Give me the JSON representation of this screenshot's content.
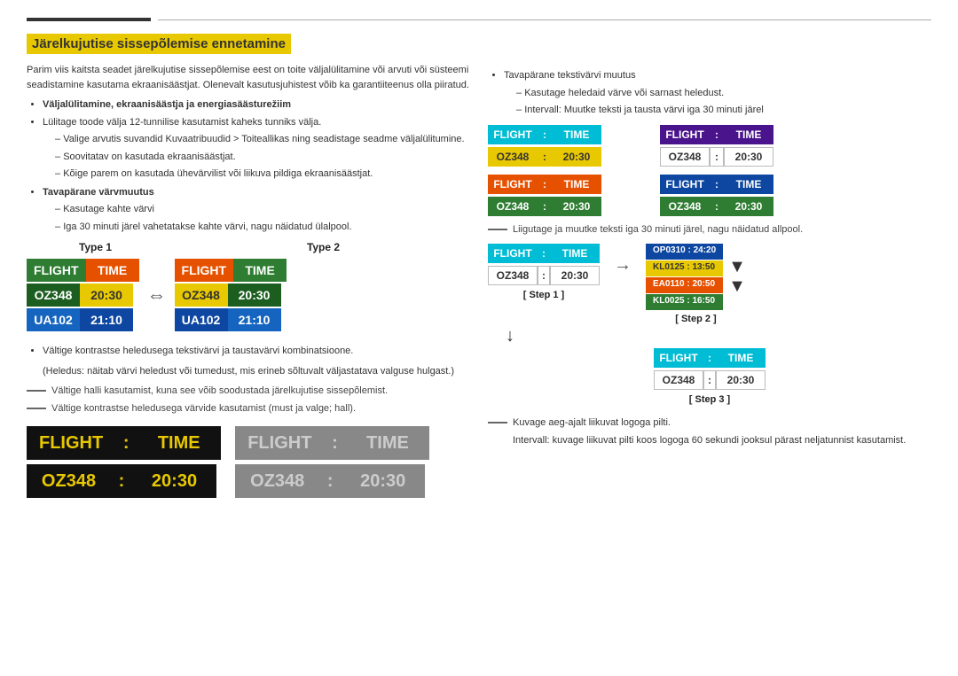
{
  "title": "Järelkujutise sissepõlemise ennetamine",
  "topline": {
    "intro": "Parim viis kaitsta seadet järelkujutise sissepõlemise eest on toite väljalülitamine või arvuti või süsteemi seadistamine kasutama ekraanisäästjat. Olenevalt kasutusjuhistest võib ka garantiiteenus olla piiratud."
  },
  "section1": {
    "title": "Väljalülitamine, ekraanisäästja ja energiasäästurežiim",
    "items": [
      "Lülitage toode välja 12-tunnilise kasutamist kaheks tunniks välja.",
      "Valige arvutis suvandid Kuvaatribuudid > Toiteallikas ning seadistage seadme väljalülitumine.",
      "Soovitatav on kasutada ekraanisäästjat.",
      "Kõige parem on kasutada ühevärvilist või liikuva pildiga ekraanisäästjat."
    ]
  },
  "section2": {
    "title": "Tavapärane värvmuutus",
    "items": [
      "Kasutage kahte värvi",
      "Iga 30 minuti järel vahetatakse kahte värvi, nagu näidatud ülalpool."
    ]
  },
  "section3": {
    "title": "Tavapärane tekstivärvi muutus",
    "items": [
      "Kasutage heledaid värve või sarnast heledust.",
      "Intervall: Muutke teksti ja tausta värvi iga 30 minuti järel"
    ]
  },
  "type1_label": "Type 1",
  "type2_label": "Type 2",
  "boards": {
    "t1_r1_c1": "FLIGHT",
    "t1_r1_c2": "TIME",
    "t1_r2_c1": "OZ348",
    "t1_r2_c2": "20:30",
    "t1_r3_c1": "UA102",
    "t1_r3_c2": "21:10",
    "t2_r1_c1": "FLIGHT",
    "t2_r1_c2": "TIME",
    "t2_r2_c1": "OZ348",
    "t2_r2_c2": "20:30",
    "t2_r3_c1": "UA102",
    "t2_r3_c2": "21:10"
  },
  "bottom_note1": "Vältige kontrastse heledusega tekstivärvi ja taustavärvi kombinatsioone.",
  "bottom_note2": "(Heledus: näitab värvi heledust või tumedust, mis erineb sõltuvalt väljastatava valguse hulgast.)",
  "warn1": "Vältige halli kasutamist, kuna see võib soodustada järelkujutise sissepõlemist.",
  "warn2": "Vältige kontrastse heledusega värvide kasutamist (must ja valge; hall).",
  "big_boards": {
    "r1_c1": "FLIGHT",
    "r1_colon": ":",
    "r1_c2": "TIME",
    "r2_c1": "OZ348",
    "r2_colon": ":",
    "r2_c2": "20:30",
    "r1b_c1": "FLIGHT",
    "r1b_colon": ":",
    "r1b_c2": "TIME",
    "r2b_c1": "OZ348",
    "r2b_colon": ":",
    "r2b_c2": "20:30"
  },
  "right_boards": {
    "b1_r1_c1": "FLIGHT",
    "b1_r1_c2": ":",
    "b1_r1_c3": "TIME",
    "b1_r2_c1": "OZ348",
    "b1_r2_c2": ":",
    "b1_r2_c3": "20:30",
    "b2_r1_c1": "FLIGHT",
    "b2_r1_c2": ":",
    "b2_r1_c3": "TIME",
    "b2_r2_c1": "OZ348",
    "b2_r2_c2": ":",
    "b2_r2_c3": "20:30",
    "b3_r1_c1": "FLIGHT",
    "b3_r1_c2": ":",
    "b3_r1_c3": "TIME",
    "b3_r2_c1": "OZ348",
    "b3_r2_c2": ":",
    "b3_r2_c3": "20:30",
    "b4_r1_c1": "FLIGHT",
    "b4_r1_c2": ":",
    "b4_r1_c3": "TIME",
    "b4_r2_c1": "OZ348",
    "b4_r2_c2": ":",
    "b4_r2_c3": "20:30"
  },
  "step_note": "Liigutage ja muutke teksti iga 30 minuti järel, nagu näidatud allpool.",
  "step1_label": "[ Step 1 ]",
  "step2_label": "[ Step 2 ]",
  "step3_label": "[ Step 3 ]",
  "step1_board": {
    "r1_c1": "FLIGHT",
    "r1_c2": ":",
    "r1_c3": "TIME",
    "r2_c1": "OZ348",
    "r2_c2": ":",
    "r2_c3": "20:30"
  },
  "step2_board": {
    "r1": "OP0310 : 24:20",
    "r2": "KL0125 : 13:50",
    "r3": "EA0110 : 20:50",
    "r4": "KL0025 : 16:50"
  },
  "step3_board": {
    "r1_c1": "FLIGHT",
    "r1_c2": ":",
    "r1_c3": "TIME",
    "r2_c1": "OZ348",
    "r2_c2": ":",
    "r2_c3": "20:30"
  },
  "logo_note": "Kuvage aeg-ajalt liikuvat logoga pilti.",
  "logo_note2": "Intervall: kuvage liikuvat pilti koos logoga 60 sekundi jooksul pärast neljatunnist kasutamist."
}
